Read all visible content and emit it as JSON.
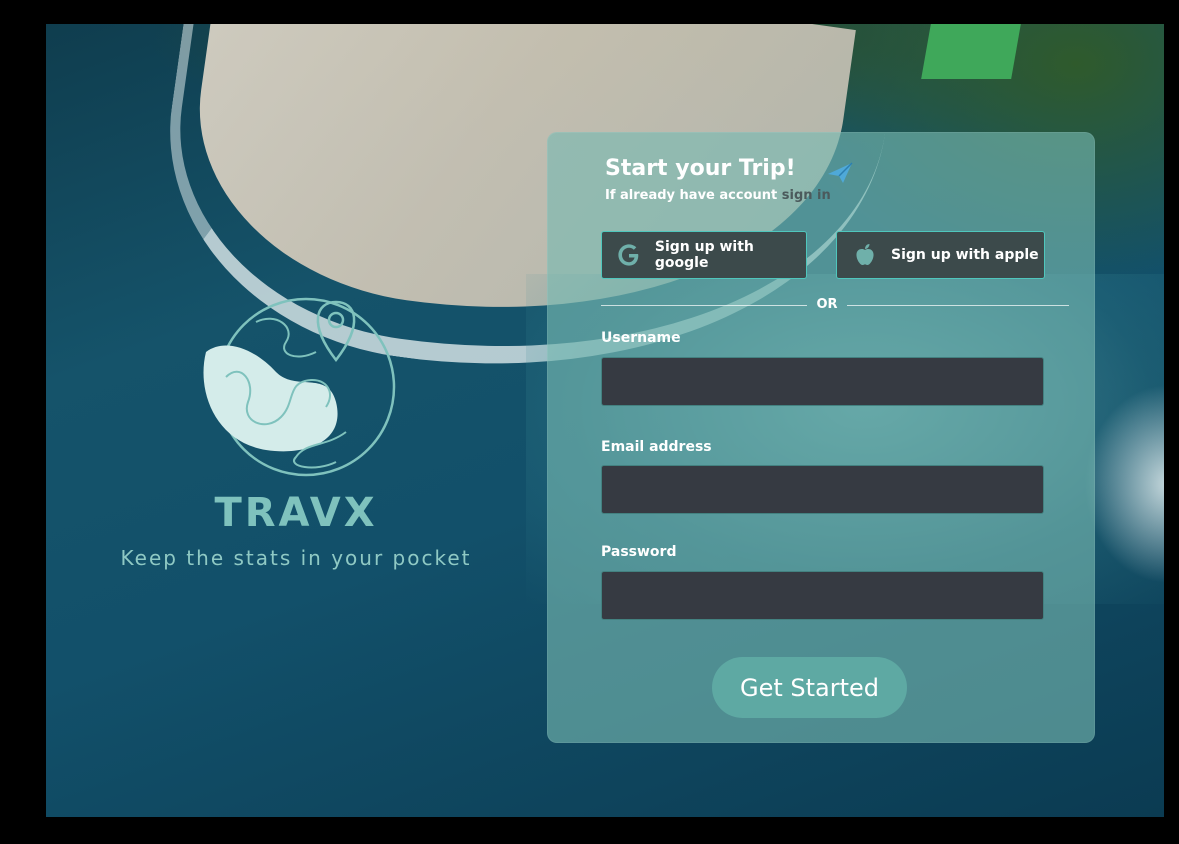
{
  "brand": {
    "name": "TRAVX",
    "tagline": "Keep the stats in your pocket"
  },
  "form": {
    "title": "Start your Trip!",
    "subtitle_prefix": "If already have account",
    "signin_link": "sign in",
    "google_button": "Sign up with google",
    "apple_button": "Sign up with apple",
    "divider": "OR",
    "username_label": "Username",
    "username_value": "",
    "email_label": "Email address",
    "email_value": "",
    "password_label": "Password",
    "password_value": "",
    "submit_label": "Get Started"
  },
  "colors": {
    "accent": "#4fc7bd",
    "panel": "#78b9b2",
    "input_bg": "#363a42",
    "button": "#5ea9a3",
    "brand_text": "#7fc2bd"
  },
  "icons": {
    "google": "google-icon",
    "apple": "apple-icon",
    "plane": "paper-plane-icon",
    "logo": "globe-pin-logo"
  }
}
